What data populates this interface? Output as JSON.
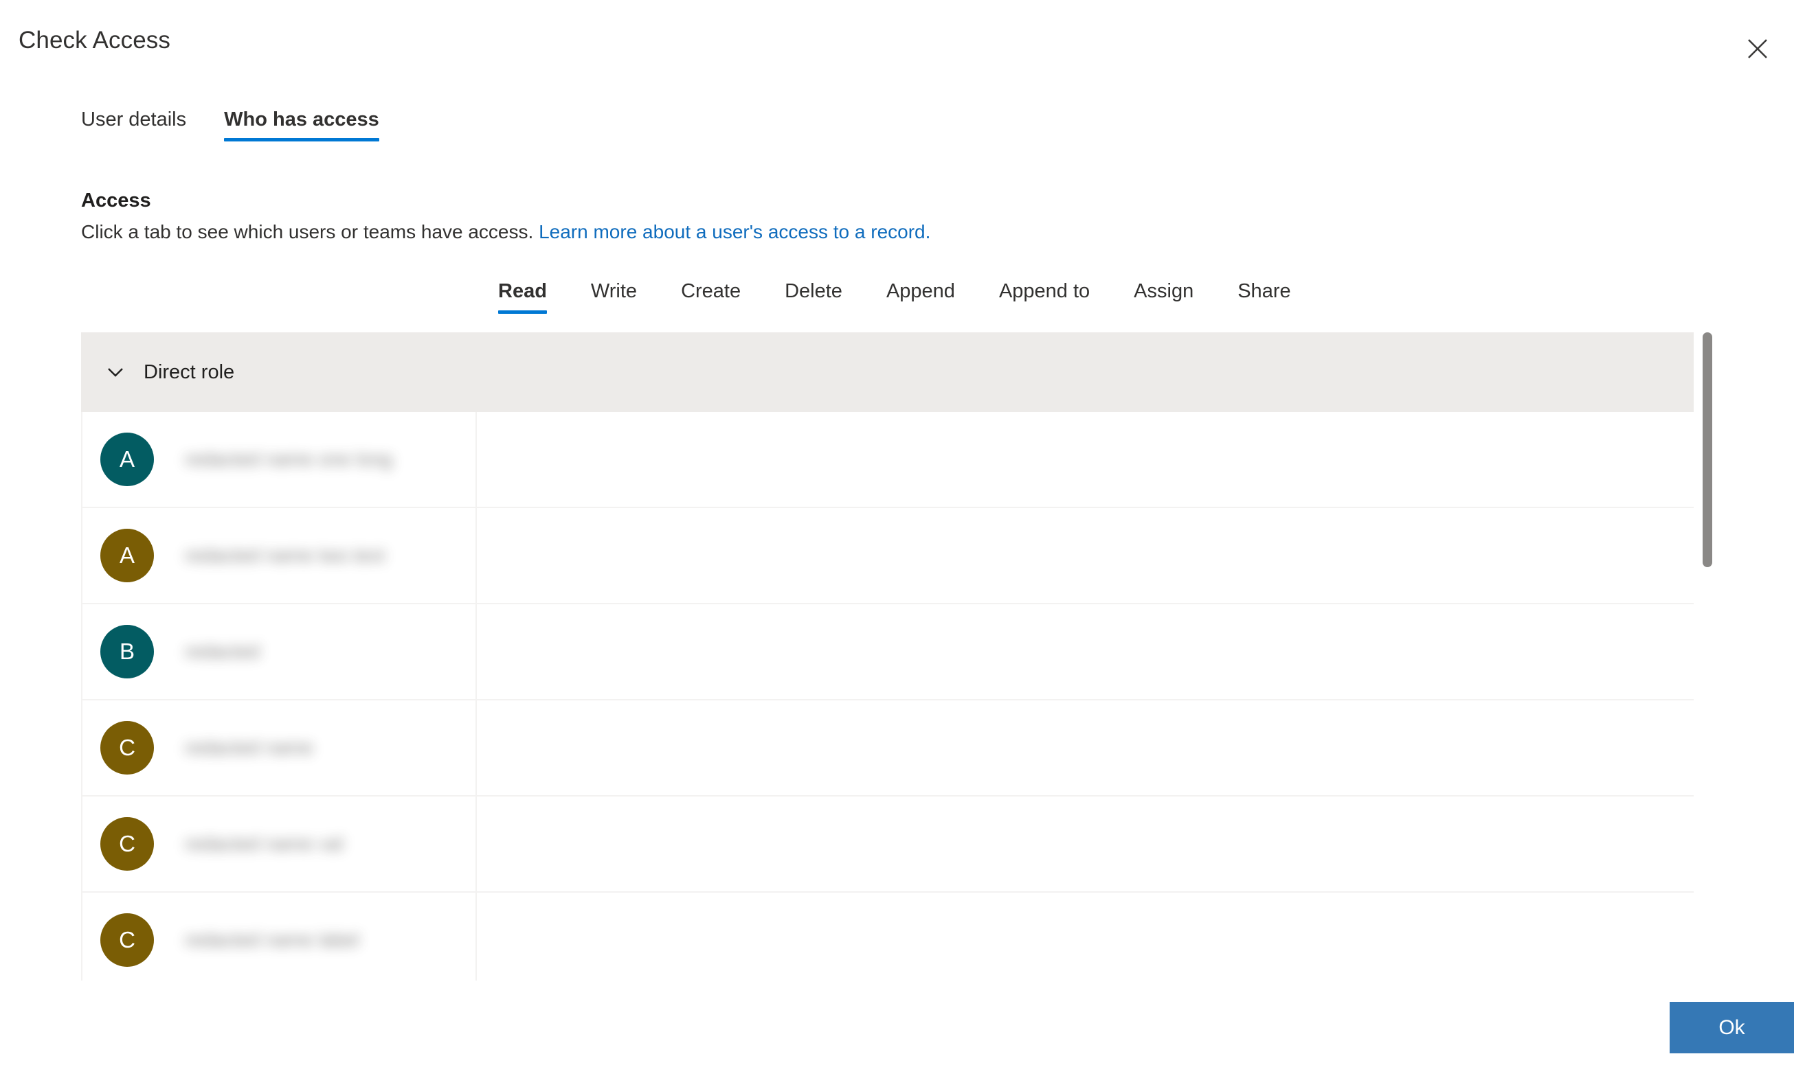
{
  "panel": {
    "title": "Check Access",
    "close_icon": "close-icon"
  },
  "top_tabs": [
    {
      "label": "User details",
      "selected": false
    },
    {
      "label": "Who has access",
      "selected": true
    }
  ],
  "access_section": {
    "heading": "Access",
    "description": "Click a tab to see which users or teams have access.",
    "link_text": "Learn more about a user's access to a record."
  },
  "permission_tabs": [
    {
      "label": "Read",
      "selected": true
    },
    {
      "label": "Write",
      "selected": false
    },
    {
      "label": "Create",
      "selected": false
    },
    {
      "label": "Delete",
      "selected": false
    },
    {
      "label": "Append",
      "selected": false
    },
    {
      "label": "Append to",
      "selected": false
    },
    {
      "label": "Assign",
      "selected": false
    },
    {
      "label": "Share",
      "selected": false
    }
  ],
  "list": {
    "group": {
      "label": "Direct role",
      "expanded": true,
      "chevron_icon": "chevron-down-icon"
    },
    "rows": [
      {
        "initial": "A",
        "avatar_color": "#035c62",
        "name": "redacted name one long"
      },
      {
        "initial": "A",
        "avatar_color": "#7a5d05",
        "name": "redacted name two text"
      },
      {
        "initial": "B",
        "avatar_color": "#035c62",
        "name": "redacted"
      },
      {
        "initial": "C",
        "avatar_color": "#7a5d05",
        "name": "redacted name"
      },
      {
        "initial": "C",
        "avatar_color": "#7a5d05",
        "name": "redacted name val"
      },
      {
        "initial": "C",
        "avatar_color": "#7a5d05",
        "name": "redacted name label"
      }
    ]
  },
  "scrollbar": {
    "orientation": "vertical"
  },
  "footer": {
    "ok_label": "Ok",
    "ok_color": "#3578b5"
  }
}
